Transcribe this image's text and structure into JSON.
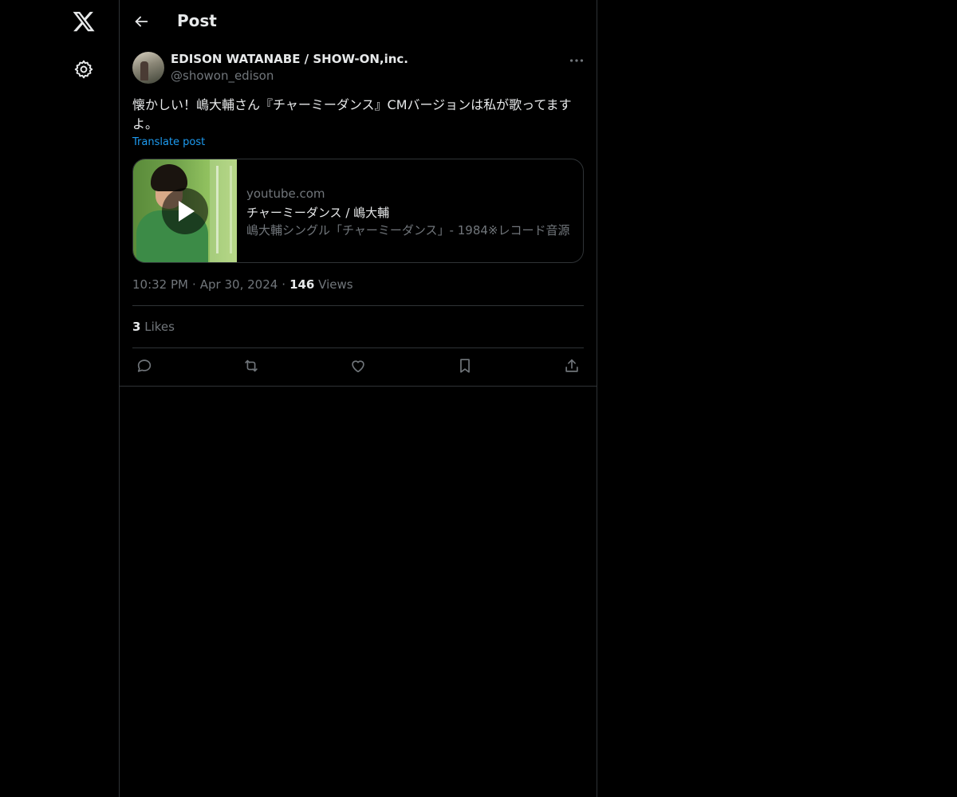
{
  "nav": {
    "logo_icon": "x-logo-icon",
    "settings_icon": "gear-icon"
  },
  "header": {
    "title": "Post",
    "back_icon": "arrow-left-icon"
  },
  "post": {
    "author_name": "EDISON WATANABE / SHOW-ON,inc.",
    "author_handle": "@showon_edison",
    "text": "懐かしい！嶋大輔さん『チャーミーダンス』CMバージョンは私が歌ってますよ。",
    "translate_label": "Translate post",
    "card": {
      "domain": "youtube.com",
      "title": "チャーミーダンス / 嶋大輔",
      "description": "嶋大輔シングル「チャーミーダンス」- 1984※レコード音源"
    },
    "time": "10:32 PM",
    "date": "Apr 30, 2024",
    "views_count": "146",
    "views_label": "Views",
    "likes_count": "3",
    "likes_label": "Likes",
    "separator": "·"
  },
  "actions": {
    "reply_icon": "reply-icon",
    "repost_icon": "repost-icon",
    "like_icon": "heart-icon",
    "bookmark_icon": "bookmark-icon",
    "share_icon": "share-icon"
  },
  "colors": {
    "background": "#000000",
    "text_primary": "#e7e9ea",
    "text_secondary": "#71767b",
    "accent": "#1d9bf0",
    "border": "#2f3336"
  }
}
